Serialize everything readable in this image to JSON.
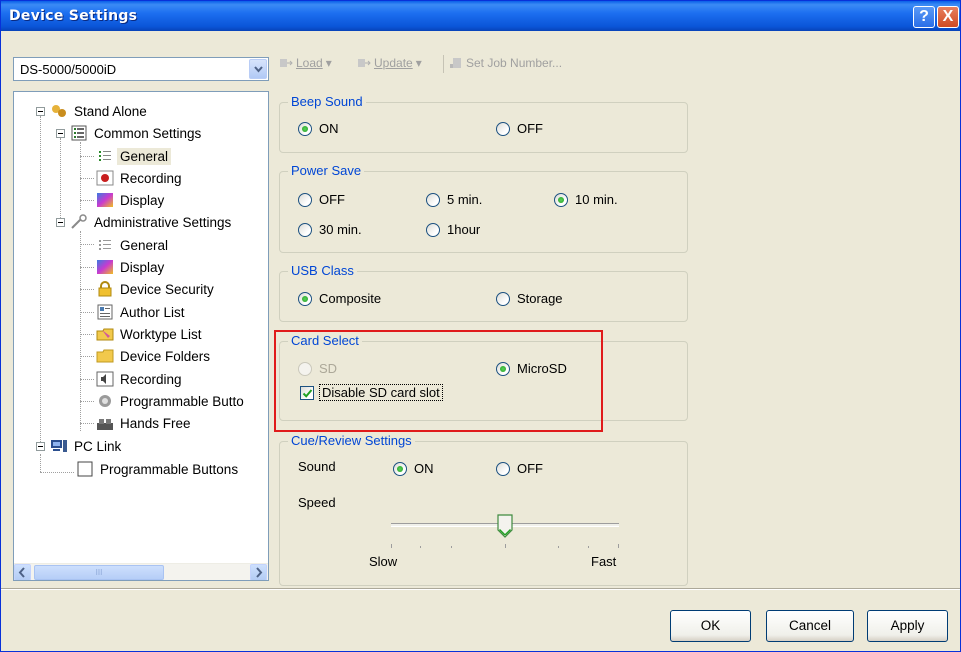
{
  "window": {
    "title": "Device Settings",
    "help_label": "?",
    "close_label": "X"
  },
  "device_select": {
    "value": "DS-5000/5000iD"
  },
  "toolbar": {
    "load": "Load",
    "update": "Update",
    "set_job": "Set Job Number..."
  },
  "tree": {
    "stand_alone": "Stand Alone",
    "common_settings": "Common Settings",
    "general": "General",
    "recording": "Recording",
    "display": "Display",
    "administrative_settings": "Administrative Settings",
    "admin_general": "General",
    "admin_display": "Display",
    "device_security": "Device Security",
    "author_list": "Author List",
    "worktype_list": "Worktype List",
    "device_folders": "Device Folders",
    "admin_recording": "Recording",
    "programmable_buttons_trunc": "Programmable Butto",
    "hands_free": "Hands Free",
    "pc_link": "PC Link",
    "pc_programmable_buttons": "Programmable Buttons",
    "scroll_grip": "III"
  },
  "beep_sound": {
    "legend": "Beep Sound",
    "on": "ON",
    "off": "OFF",
    "selected": "ON"
  },
  "power_save": {
    "legend": "Power Save",
    "off": "OFF",
    "min5": "5 min.",
    "min10": "10 min.",
    "min30": "30 min.",
    "hour1": "1hour",
    "selected": "10 min."
  },
  "usb_class": {
    "legend": "USB Class",
    "composite": "Composite",
    "storage": "Storage",
    "selected": "Composite"
  },
  "card_select": {
    "legend": "Card Select",
    "sd": "SD",
    "microsd": "MicroSD",
    "selected": "MicroSD",
    "disable_sd": "Disable SD card slot",
    "disable_sd_checked": true
  },
  "cue_review": {
    "legend": "Cue/Review Settings",
    "sound_label": "Sound",
    "on": "ON",
    "off": "OFF",
    "selected": "ON",
    "speed_label": "Speed",
    "slow": "Slow",
    "fast": "Fast",
    "speed_level": 0.5
  },
  "buttons": {
    "ok": "OK",
    "cancel": "Cancel",
    "apply": "Apply"
  },
  "colors": {
    "title_bar": "#0a5fe8",
    "legend_text": "#0046d5",
    "highlight_box": "#e01b1b",
    "window_bg": "#ece9d8"
  }
}
